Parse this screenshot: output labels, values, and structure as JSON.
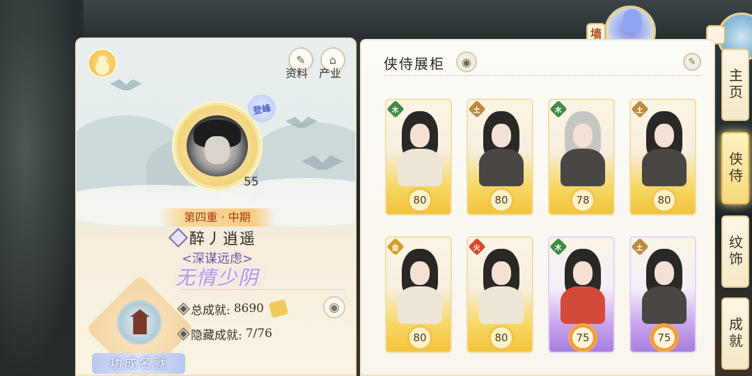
{
  "top_orbs": {
    "left_tag": "墙",
    "right_tag": ""
  },
  "profile": {
    "links": [
      {
        "label": "资料"
      },
      {
        "label": "产业"
      }
    ],
    "seal_text": "登峰",
    "level": "55",
    "rank": "第四重 · 中期",
    "name": "醉丿逍遥",
    "motto": "<深谋远虑>",
    "title": "无情少阴",
    "total_achievement_label": "总成就:",
    "total_achievement_value": "8690",
    "hidden_achievement_label": "隐藏成就:",
    "hidden_achievement_value": "7/76",
    "emblem_label": "功成名就"
  },
  "showcase": {
    "title": "侠侍展柜",
    "cards": [
      {
        "element": "木",
        "level": "80",
        "rarity": "gold"
      },
      {
        "element": "土",
        "level": "80",
        "rarity": "gold"
      },
      {
        "element": "木",
        "level": "78",
        "rarity": "gold"
      },
      {
        "element": "土",
        "level": "80",
        "rarity": "gold"
      },
      {
        "element": "金",
        "level": "80",
        "rarity": "gold"
      },
      {
        "element": "火",
        "level": "80",
        "rarity": "gold"
      },
      {
        "element": "木",
        "level": "75",
        "rarity": "purple"
      },
      {
        "element": "土",
        "level": "75",
        "rarity": "purple"
      }
    ]
  },
  "side_tabs": [
    {
      "label": "主页",
      "active": false
    },
    {
      "label": "侠侍",
      "active": true
    },
    {
      "label": "纹饰",
      "active": false
    },
    {
      "label": "成就",
      "active": false
    }
  ],
  "icons": {
    "avatar": "avatar-icon",
    "profile_link": "scroll-icon",
    "industry_link": "house-icon",
    "eye": "eye-icon",
    "edit": "edit-icon",
    "achievement": "trophy-icon"
  },
  "colors": {
    "gold_card": "#f4c43b",
    "purple_card": "#a77ee0",
    "title_purple": "#b492e6",
    "rank_red": "#a23a16"
  }
}
